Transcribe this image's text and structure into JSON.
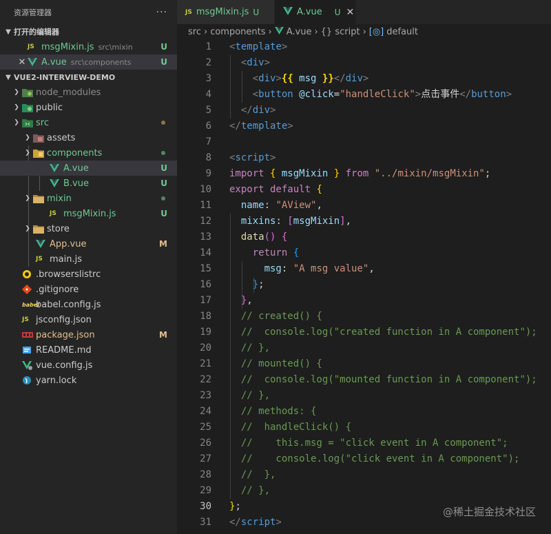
{
  "explorer": {
    "title": "资源管理器",
    "more": "···",
    "open_editors": {
      "title": "打开的编辑器",
      "items": [
        {
          "icon": "JS",
          "name": "msgMixin.js",
          "path": "src\\mixin",
          "badge": "U"
        },
        {
          "icon": "vue",
          "name": "A.vue",
          "path": "src\\components",
          "badge": "U"
        }
      ]
    },
    "project": {
      "title": "VUE2-INTERVIEW-DEMO",
      "tree": [
        {
          "name": "node_modules",
          "icon": "node-folder-icon"
        },
        {
          "name": "public",
          "icon": "public-folder-icon"
        },
        {
          "name": "src",
          "icon": "src-folder-icon"
        },
        {
          "name": "assets",
          "icon": "assets-folder-icon"
        },
        {
          "name": "components",
          "icon": "components-folder-icon"
        },
        {
          "name": "A.vue",
          "icon": "vue-icon",
          "badge": "U"
        },
        {
          "name": "B.vue",
          "icon": "vue-icon",
          "badge": "U"
        },
        {
          "name": "mixin",
          "icon": "folder-icon"
        },
        {
          "name": "msgMixin.js",
          "icon": "js-icon",
          "badge": "U"
        },
        {
          "name": "store",
          "icon": "folder-icon"
        },
        {
          "name": "App.vue",
          "icon": "vue-icon",
          "badge": "M"
        },
        {
          "name": "main.js",
          "icon": "js-icon"
        },
        {
          "name": ".browserslistrc",
          "icon": "browserslist-icon"
        },
        {
          "name": ".gitignore",
          "icon": "git-icon"
        },
        {
          "name": "babel.config.js",
          "icon": "babel-icon"
        },
        {
          "name": "jsconfig.json",
          "icon": "js-icon"
        },
        {
          "name": "package.json",
          "icon": "npm-icon",
          "badge": "M"
        },
        {
          "name": "README.md",
          "icon": "readme-icon"
        },
        {
          "name": "vue.config.js",
          "icon": "vue-config-icon"
        },
        {
          "name": "yarn.lock",
          "icon": "yarn-icon"
        }
      ]
    }
  },
  "tabs": [
    {
      "icon": "JS",
      "name": "msgMixin.js",
      "mark": "U"
    },
    {
      "icon": "vue",
      "name": "A.vue",
      "mark": "U",
      "close": "✕"
    }
  ],
  "breadcrumb": [
    "src",
    "components",
    "A.vue",
    "{} script",
    "default"
  ],
  "editor": {
    "current_line": 30,
    "line_numbers": [
      "1",
      "2",
      "3",
      "4",
      "5",
      "6",
      "7",
      "8",
      "9",
      "10",
      "11",
      "12",
      "13",
      "14",
      "15",
      "16",
      "17",
      "18",
      "19",
      "20",
      "21",
      "22",
      "23",
      "24",
      "25",
      "26",
      "27",
      "28",
      "29",
      "30",
      "31"
    ],
    "code": {
      "l1_open": "<",
      "l1_tag": "template",
      "l1_close": ">",
      "l2_open": "<",
      "l2_tag": "div",
      "l2_close": ">",
      "l3_open": "<",
      "l3_tag": "div",
      "l3_close": ">",
      "l3_mus_open": "{{",
      "l3_var": " msg ",
      "l3_mus_close": "}}",
      "l3_end_open": "</",
      "l3_end_tag": "div",
      "l3_end_close": ">",
      "l4_open": "<",
      "l4_tag": "button",
      "l4_attr": " @click",
      "l4_eq": "=",
      "l4_val": "\"handleClick\"",
      "l4_gt": ">",
      "l4_text": "点击事件",
      "l4_end_open": "</",
      "l4_end_tag": "button",
      "l4_end_close": ">",
      "l5_open": "</",
      "l5_tag": "div",
      "l5_close": ">",
      "l6_open": "</",
      "l6_tag": "template",
      "l6_close": ">",
      "l8_open": "<",
      "l8_tag": "script",
      "l8_close": ">",
      "l9_import": "import",
      "l9_lb": " { ",
      "l9_name": "msgMixin",
      "l9_rb": " } ",
      "l9_from": "from",
      "l9_path": " \"../mixin/msgMixin\"",
      "l9_semi": ";",
      "l10_export": "export",
      "l10_default": " default",
      "l10_brace": " {",
      "l11_key": "name",
      "l11_colon": ": ",
      "l11_val": "\"AView\"",
      "l11_comma": ",",
      "l12_key": "mixins",
      "l12_colon": ": ",
      "l12_lb": "[",
      "l12_val": "msgMixin",
      "l12_rb": "]",
      "l12_comma": ",",
      "l13_fn": "data",
      "l13_paren": "()",
      "l13_brace": " {",
      "l14_return": "return",
      "l14_brace": " {",
      "l15_key": "msg",
      "l15_colon": ": ",
      "l15_val": "\"A msg value\"",
      "l15_comma": ",",
      "l16_brace": "}",
      "l16_semi": ";",
      "l17_brace": "}",
      "l17_comma": ",",
      "l18": "// created() {",
      "l19": "//  console.log(\"created function in A component\");",
      "l20": "// },",
      "l21": "// mounted() {",
      "l22": "//  console.log(\"mounted function in A component\");",
      "l23": "// },",
      "l24": "// methods: {",
      "l25": "//  handleClick() {",
      "l26": "//    this.msg = \"click event in A component\";",
      "l27": "//    console.log(\"click event in A component\");",
      "l28": "//  },",
      "l29": "// },",
      "l30_brace": "}",
      "l30_semi": ";",
      "l31_open": "</",
      "l31_tag": "script",
      "l31_close": ">"
    }
  },
  "watermark": "@稀土掘金技术社区",
  "colors": {
    "sidebar_bg": "#252526",
    "editor_bg": "#1e1e1e",
    "untracked": "#73c991",
    "modified": "#e2c08d",
    "vue_green": "#41b883",
    "js_yellow": "#cbcb41"
  }
}
